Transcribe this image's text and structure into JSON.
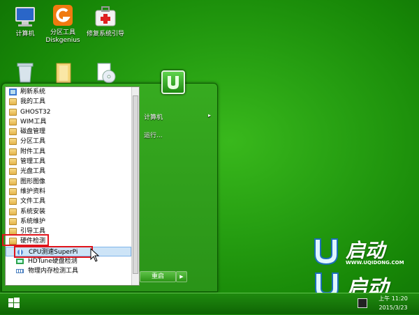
{
  "desktop": {
    "icons": [
      {
        "label": "计算机"
      },
      {
        "label": "分区工具\nDiskgenius"
      },
      {
        "label": "修复系统引导"
      },
      {
        "label": ""
      },
      {
        "label": ""
      },
      {
        "label": ""
      }
    ]
  },
  "start_menu": {
    "programs": [
      {
        "label": "刷新系统",
        "icon": "refresh-icon"
      },
      {
        "label": "我的工具",
        "icon": "folder-icon"
      },
      {
        "label": "GHOST32",
        "icon": "folder-icon"
      },
      {
        "label": "WIM工具",
        "icon": "folder-icon"
      },
      {
        "label": "磁盘管理",
        "icon": "folder-icon"
      },
      {
        "label": "分区工具",
        "icon": "folder-icon"
      },
      {
        "label": "附件工具",
        "icon": "folder-icon"
      },
      {
        "label": "管理工具",
        "icon": "folder-icon"
      },
      {
        "label": "光盘工具",
        "icon": "folder-icon"
      },
      {
        "label": "图形图像",
        "icon": "folder-icon"
      },
      {
        "label": "维护资料",
        "icon": "folder-icon"
      },
      {
        "label": "文件工具",
        "icon": "folder-icon"
      },
      {
        "label": "系统安装",
        "icon": "folder-icon"
      },
      {
        "label": "系统维护",
        "icon": "folder-icon"
      },
      {
        "label": "引导工具",
        "icon": "folder-icon"
      },
      {
        "label": "硬件检测",
        "icon": "folder-icon"
      }
    ],
    "subitems": [
      {
        "label": "CPU测速SuperPi",
        "icon": "app-icon"
      },
      {
        "label": "HDTune硬盘检测",
        "icon": "app-icon"
      },
      {
        "label": "物理内存检测工具",
        "icon": "app-icon"
      }
    ],
    "right": {
      "computer_label": "计算机",
      "run_label": "运行..."
    },
    "restart_label": "重启"
  },
  "brand": {
    "logo_text": "启动",
    "site": "WWW.UQIDONG.COM"
  },
  "tray": {
    "time": "上午 11:20",
    "date": "2015/3/23"
  },
  "colors": {
    "highlight_box": "#e0141b",
    "desktop_green": "#27a012"
  }
}
